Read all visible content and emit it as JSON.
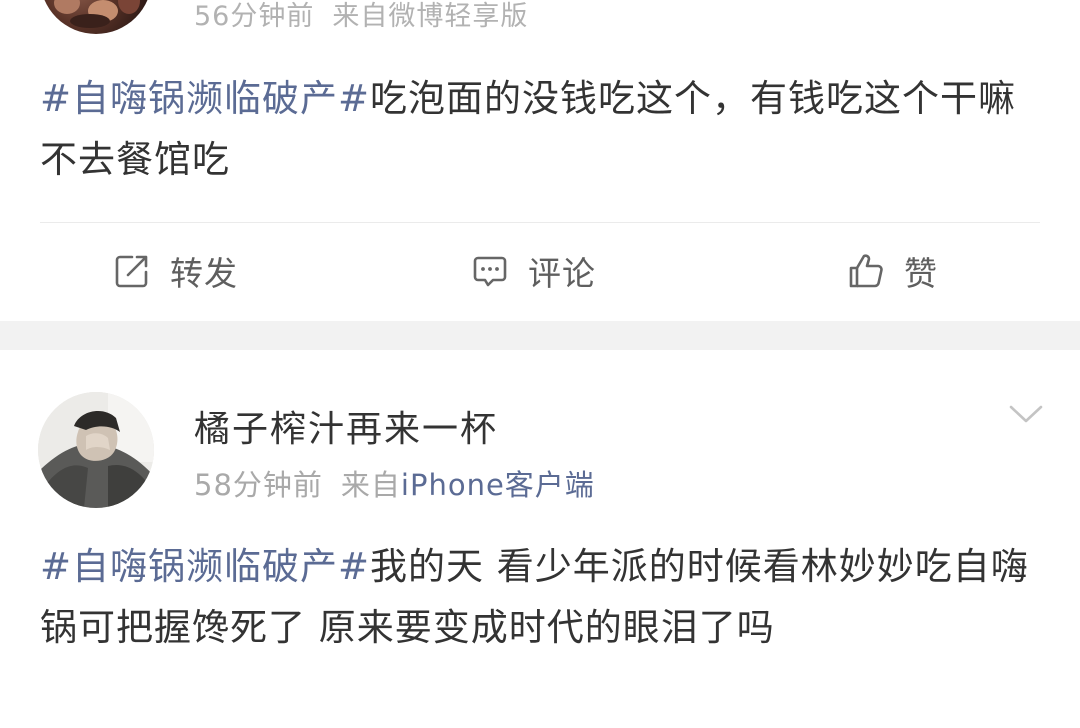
{
  "post1": {
    "time": "56分钟前",
    "source": "来自微博轻享版",
    "topic": "#自嗨锅濒临破产#",
    "text": "吃泡面的没钱吃这个，有钱吃这个干嘛不去餐馆吃",
    "actions": {
      "repost": "转发",
      "comment": "评论",
      "like": "赞"
    }
  },
  "post2": {
    "username": "橘子榨汁再来一杯",
    "time": "58分钟前",
    "source_prefix": "来自",
    "source_client": "iPhone客户端",
    "topic": "#自嗨锅濒临破产#",
    "text": "我的天 看少年派的时候看林妙妙吃自嗨锅可把握馋死了 原来要变成时代的眼泪了吗"
  },
  "icons": {
    "repost": "edit-share-icon",
    "comment": "comment-bubble-icon",
    "like": "thumbs-up-icon",
    "menu": "chevron-down-icon"
  },
  "colors": {
    "topic": "#5b6b94",
    "meta": "#b2b2b2",
    "separator": "#f2f2f2"
  }
}
